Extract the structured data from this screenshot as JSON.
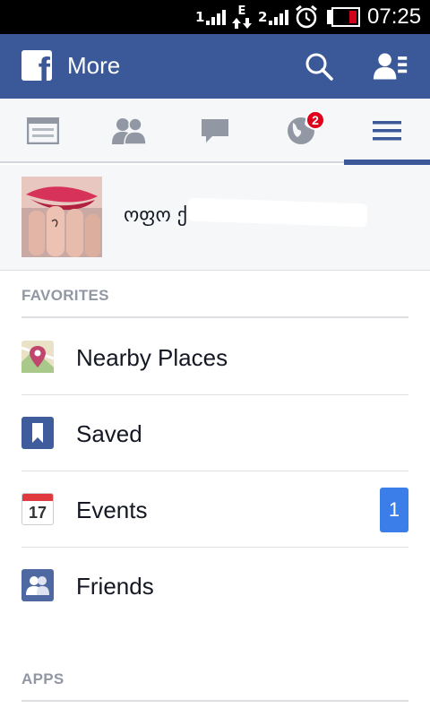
{
  "status_bar": {
    "sim1_label": "1",
    "network_type": "E",
    "sim2_label": "2",
    "time": "07:25",
    "battery_color": "#d0021b"
  },
  "app_bar": {
    "title": "More",
    "logo": "f",
    "search_icon": "search-icon",
    "friend_requests_icon": "friend-requests-icon",
    "color": "#3b5998"
  },
  "tabs": [
    {
      "name": "news-feed",
      "icon": "news-feed-icon"
    },
    {
      "name": "friends",
      "icon": "friends-icon"
    },
    {
      "name": "messages",
      "icon": "messages-icon"
    },
    {
      "name": "notifications",
      "icon": "globe-icon",
      "badge": "2"
    },
    {
      "name": "more",
      "icon": "menu-icon",
      "active": true
    }
  ],
  "profile": {
    "name": "ოფო ქ"
  },
  "favorites": {
    "header": "FAVORITES",
    "items": [
      {
        "label": "Nearby Places",
        "icon": "map-pin-icon"
      },
      {
        "label": "Saved",
        "icon": "bookmark-icon"
      },
      {
        "label": "Events",
        "icon": "calendar-icon",
        "calendar_day": "17",
        "count": "1"
      },
      {
        "label": "Friends",
        "icon": "friends-icon"
      }
    ]
  },
  "apps": {
    "header": "APPS"
  }
}
